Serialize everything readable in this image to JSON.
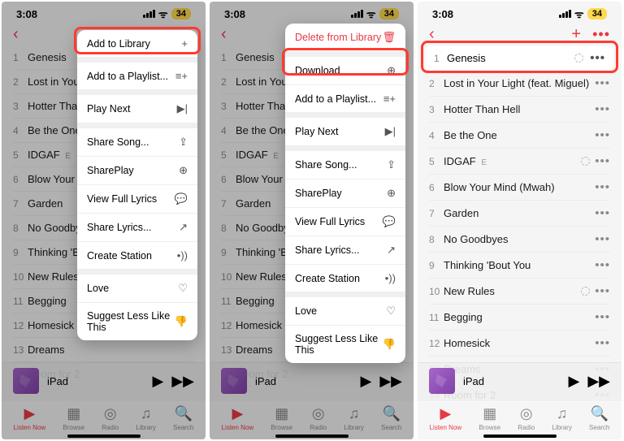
{
  "status": {
    "time": "3:08",
    "battery": "34"
  },
  "tracks": [
    {
      "n": "1",
      "t": "Genesis",
      "e": false
    },
    {
      "n": "2",
      "t": "Lost in Your Light (feat. Miguel)",
      "e": false
    },
    {
      "n": "3",
      "t": "Hotter Than Hell",
      "e": false
    },
    {
      "n": "4",
      "t": "Be the One",
      "e": false
    },
    {
      "n": "5",
      "t": "IDGAF",
      "e": true
    },
    {
      "n": "6",
      "t": "Blow Your Mind (Mwah)",
      "e": false
    },
    {
      "n": "7",
      "t": "Garden",
      "e": false
    },
    {
      "n": "8",
      "t": "No Goodbyes",
      "e": false
    },
    {
      "n": "9",
      "t": "Thinking 'Bout You",
      "e": false
    },
    {
      "n": "10",
      "t": "New Rules",
      "e": false
    },
    {
      "n": "11",
      "t": "Begging",
      "e": false
    },
    {
      "n": "12",
      "t": "Homesick",
      "e": false
    },
    {
      "n": "13",
      "t": "Dreams",
      "e": false
    },
    {
      "n": "14",
      "t": "Room for 2",
      "e": false
    }
  ],
  "nowplaying": {
    "title": "iPad"
  },
  "tabs": [
    {
      "label": "Listen Now",
      "icon": "▶"
    },
    {
      "label": "Browse",
      "icon": "▦"
    },
    {
      "label": "Radio",
      "icon": "◎"
    },
    {
      "label": "Library",
      "icon": "♫"
    },
    {
      "label": "Search",
      "icon": "🔍"
    }
  ],
  "menuA": {
    "top": "Add to Library",
    "items": [
      "Add to a Playlist...",
      "Play Next",
      "Share Song...",
      "SharePlay",
      "View Full Lyrics",
      "Share Lyrics...",
      "Create Station",
      "Love",
      "Suggest Less Like This"
    ],
    "icons": [
      "≡+",
      "▶|",
      "⇪",
      "⊕",
      "💬",
      "↗",
      "•))",
      "♡",
      "👎"
    ]
  },
  "menuB": {
    "top": "Delete from Library",
    "highlight": "Download",
    "items": [
      "Add to a Playlist...",
      "Play Next",
      "Share Song...",
      "SharePlay",
      "View Full Lyrics",
      "Share Lyrics...",
      "Create Station",
      "Love",
      "Suggest Less Like This"
    ],
    "icons": [
      "≡+",
      "▶|",
      "⇪",
      "⊕",
      "💬",
      "↗",
      "•))",
      "♡",
      "👎"
    ]
  },
  "highlightTrack": {
    "n": "1",
    "t": "Genesis"
  },
  "icons": {
    "plus": "+",
    "trash": "🗑",
    "download": "⊕"
  }
}
